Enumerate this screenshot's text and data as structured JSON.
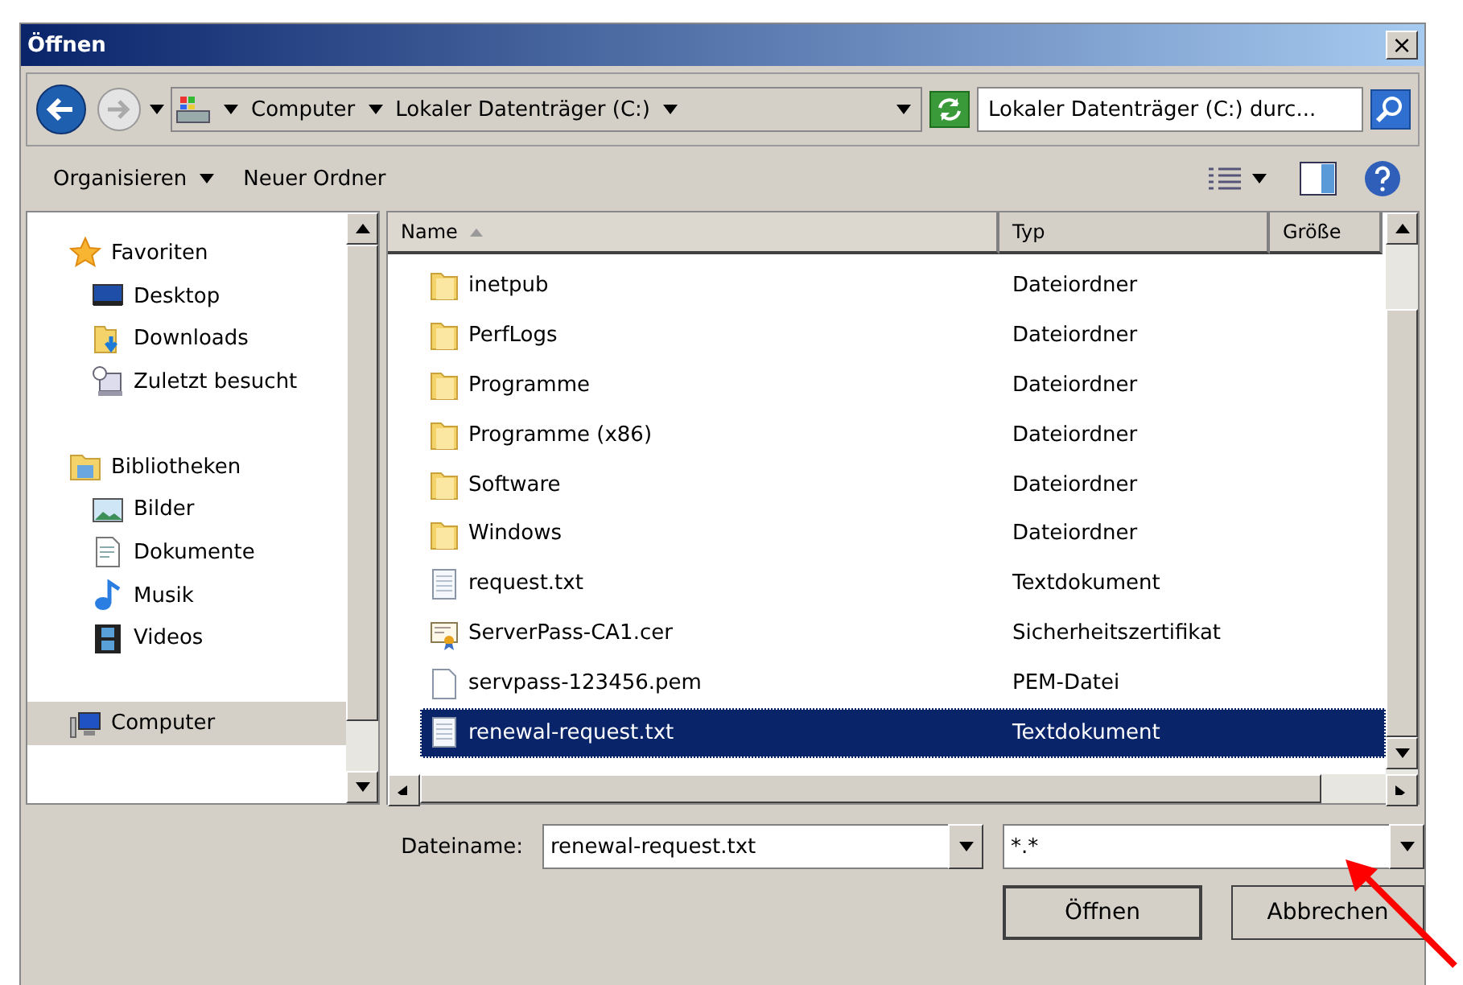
{
  "window": {
    "title": "Öffnen",
    "close": "×"
  },
  "nav": {
    "breadcrumb": [
      "Computer",
      "Lokaler Datenträger (C:)"
    ],
    "search_placeholder": "Lokaler Datenträger (C:) durc..."
  },
  "toolbar": [
    {
      "label": "Organisieren",
      "menu": true
    },
    {
      "label": "Neuer Ordner",
      "menu": false
    }
  ],
  "sidebar": [
    {
      "label": "Favoriten",
      "kind": "star",
      "selected": false,
      "children": [
        {
          "label": "Desktop",
          "kind": "desktop",
          "selected": false
        },
        {
          "label": "Downloads",
          "kind": "download",
          "selected": false
        },
        {
          "label": "Zuletzt besucht",
          "kind": "recent",
          "selected": false
        }
      ]
    },
    {
      "label": "Bibliotheken",
      "kind": "library",
      "selected": false,
      "children": [
        {
          "label": "Bilder",
          "kind": "image",
          "selected": false
        },
        {
          "label": "Dokumente",
          "kind": "doc",
          "selected": false
        },
        {
          "label": "Musik",
          "kind": "music",
          "selected": false
        },
        {
          "label": "Videos",
          "kind": "video",
          "selected": false
        }
      ]
    },
    {
      "label": "Computer",
      "kind": "computer",
      "selected": true
    }
  ],
  "table": {
    "columns": [
      {
        "label": "Name",
        "sorted": true
      },
      {
        "label": "Typ",
        "sorted": false
      },
      {
        "label": "Größe",
        "sorted": false
      }
    ],
    "rows": [
      {
        "name": "inetpub",
        "type": "Dateiordner",
        "kind": "folder",
        "selected": false
      },
      {
        "name": "PerfLogs",
        "type": "Dateiordner",
        "kind": "folder",
        "selected": false
      },
      {
        "name": "Programme",
        "type": "Dateiordner",
        "kind": "folder",
        "selected": false
      },
      {
        "name": "Programme (x86)",
        "type": "Dateiordner",
        "kind": "folder",
        "selected": false
      },
      {
        "name": "Software",
        "type": "Dateiordner",
        "kind": "folder",
        "selected": false
      },
      {
        "name": "Windows",
        "type": "Dateiordner",
        "kind": "folder",
        "selected": false
      },
      {
        "name": "request.txt",
        "type": "Textdokument",
        "kind": "text",
        "selected": false
      },
      {
        "name": "ServerPass-CA1.cer",
        "type": "Sicherheitszertifikat",
        "kind": "cert",
        "selected": false
      },
      {
        "name": "servpass-123456.pem",
        "type": "PEM-Datei",
        "kind": "file",
        "selected": false
      },
      {
        "name": "renewal-request.txt",
        "type": "Textdokument",
        "kind": "text",
        "selected": true
      }
    ]
  },
  "filename": {
    "label": "Dateiname:",
    "value": "renewal-request.txt"
  },
  "filter": {
    "value": "*.*"
  },
  "buttons": [
    {
      "label": "Öffnen",
      "default": true
    },
    {
      "label": "Abbrechen",
      "default": false
    }
  ]
}
